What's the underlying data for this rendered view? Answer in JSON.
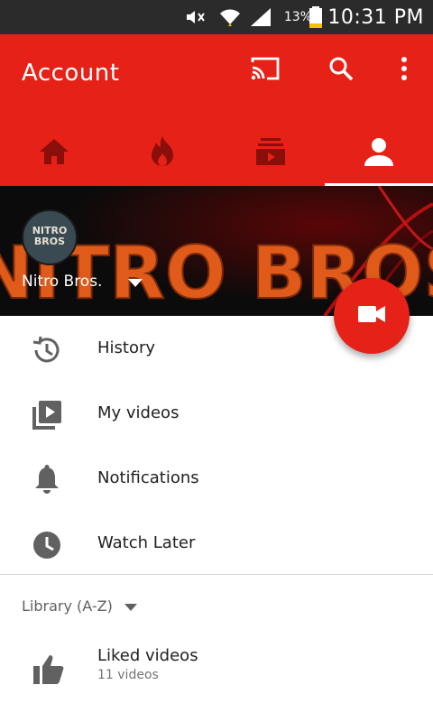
{
  "status_bar": {
    "battery_percent": "13%",
    "time": "10:31 PM",
    "icons": [
      "mute-icon",
      "wifi-icon",
      "signal-icon",
      "battery-icon"
    ]
  },
  "app_bar": {
    "title": "Account",
    "actions": [
      "cast-icon",
      "search-icon",
      "more-vert-icon"
    ],
    "accent_color": "#e62117"
  },
  "tabs": [
    {
      "name": "home",
      "icon": "home-icon",
      "active": false
    },
    {
      "name": "trending",
      "icon": "flame-icon",
      "active": false
    },
    {
      "name": "subscriptions",
      "icon": "subscriptions-icon",
      "active": false
    },
    {
      "name": "account",
      "icon": "person-icon",
      "active": true
    }
  ],
  "channel": {
    "avatar_text": "NITRO BROS",
    "banner_text": "NITRO BROS",
    "name": "Nitro Bros."
  },
  "fab": {
    "icon": "videocam-icon"
  },
  "menu": {
    "items": [
      {
        "label": "History",
        "icon": "history-icon"
      },
      {
        "label": "My videos",
        "icon": "my-videos-icon"
      },
      {
        "label": "Notifications",
        "icon": "bell-icon"
      },
      {
        "label": "Watch Later",
        "icon": "clock-icon"
      }
    ]
  },
  "library": {
    "header": "Library (A-Z)",
    "items": [
      {
        "label": "Liked videos",
        "subtitle": "11 videos",
        "icon": "thumbs-up-icon"
      }
    ]
  }
}
